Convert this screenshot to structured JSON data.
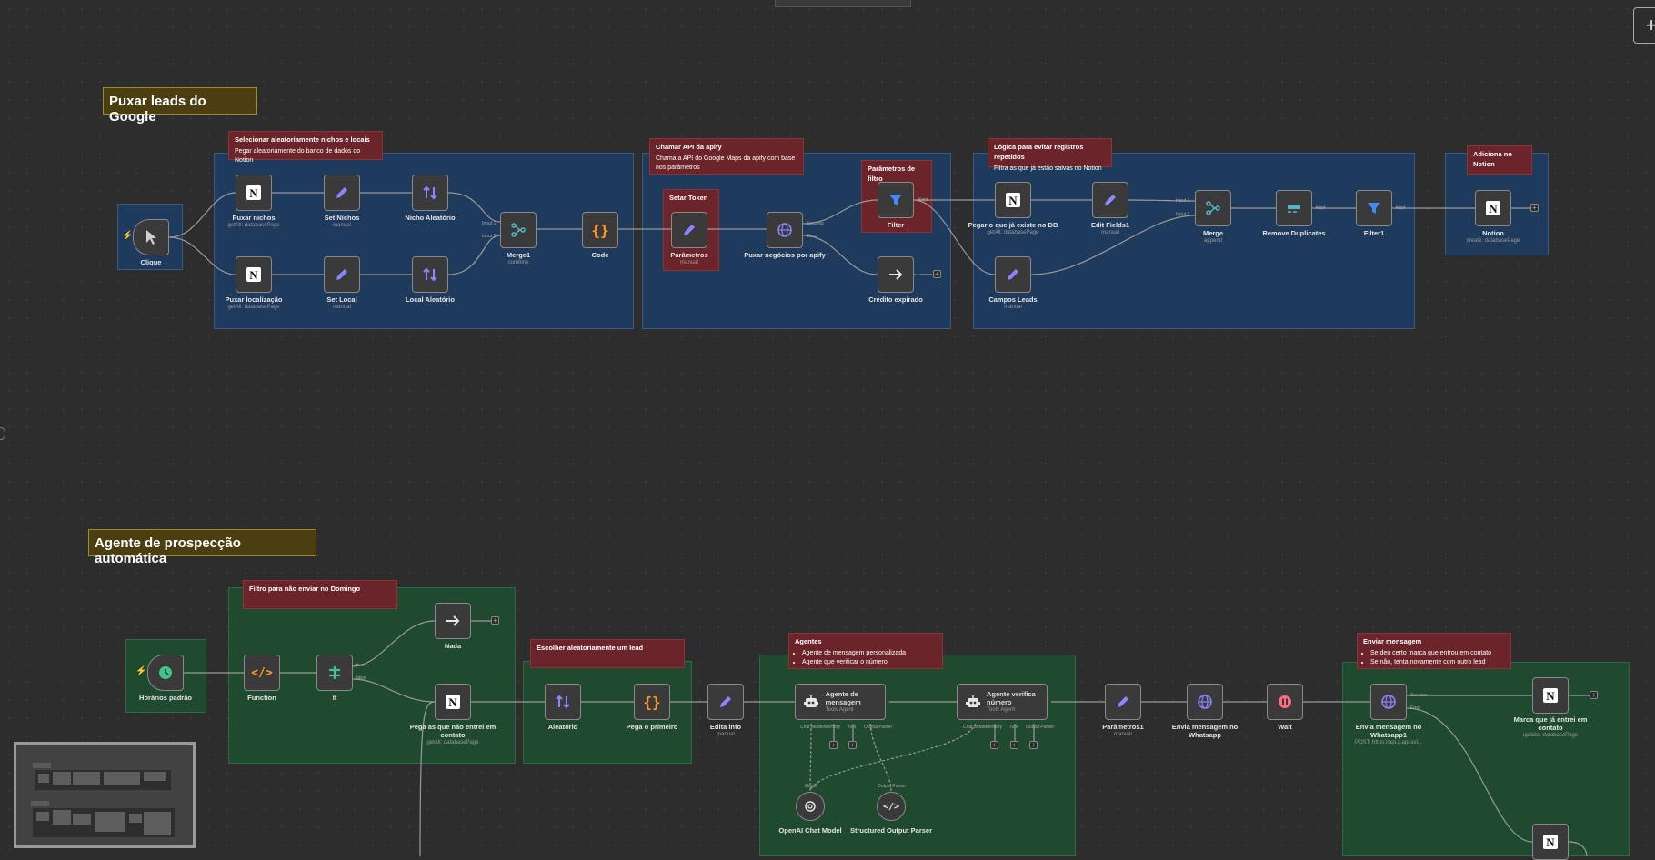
{
  "top_bar": {
    "visible": true
  },
  "add_button_label": "+",
  "sections": [
    {
      "title": "Puxar leads do Google"
    },
    {
      "title": "Agente de prospecção automática"
    }
  ],
  "stickies": {
    "s1": {
      "title": "Selecionar aleatoriamente nichos e locais",
      "body": "Pegar aleatoriamente do banco de dados do Notion"
    },
    "s2": {
      "title": "Chamar API da apify",
      "body": "Chama a API do Google Maps da apify com base nos parâmetros"
    },
    "s3": {
      "title": "Setar Token",
      "body": ""
    },
    "s4": {
      "title": "Parâmetros de filtro",
      "body": ""
    },
    "s5": {
      "title": "Lógica para evitar registros repetidos",
      "body": "Filtra as que já estão salvas no Notion"
    },
    "s6": {
      "title": "Adiciona no Notion",
      "body": ""
    },
    "s7": {
      "title": "Filtro para não enviar no Domingo",
      "body": ""
    },
    "s8": {
      "title": "Escolher aleatoriamente um lead",
      "body": ""
    },
    "s9": {
      "title": "Agentes",
      "items": [
        "Agente de mensagem personalizada",
        "Agente que verificar o número"
      ]
    },
    "s10": {
      "title": "Enviar mensagem",
      "items": [
        "Se deu certo marca que entrou em contato",
        "Se não, tenta novamente com outro lead"
      ]
    }
  },
  "nodes": {
    "clique": {
      "name": "Clique",
      "sub": ""
    },
    "puxar_nichos": {
      "name": "Puxar nichos",
      "sub": "getAll: databasePage"
    },
    "set_nichos": {
      "name": "Set Nichos",
      "sub": "manual"
    },
    "nicho_aleatorio": {
      "name": "Nicho Aleatório",
      "sub": ""
    },
    "puxar_localizacao": {
      "name": "Puxar localização",
      "sub": "getAll: databasePage"
    },
    "set_local": {
      "name": "Set Local",
      "sub": "manual"
    },
    "local_aleatorio": {
      "name": "Local Aleatório",
      "sub": ""
    },
    "merge1": {
      "name": "Merge1",
      "sub": "combine"
    },
    "code": {
      "name": "Code",
      "sub": ""
    },
    "parametros": {
      "name": "Parâmetros",
      "sub": "manual"
    },
    "puxar_negocios": {
      "name": "Puxar negócios por apify",
      "sub": ""
    },
    "filter": {
      "name": "Filter",
      "sub": ""
    },
    "credito_expirado": {
      "name": "Crédito expirado",
      "sub": ""
    },
    "pegar_db": {
      "name": "Pegar o que já existe no DB",
      "sub": "getAll: databasePage"
    },
    "edit_fields1": {
      "name": "Edit Fields1",
      "sub": "manual"
    },
    "campos_leads": {
      "name": "Campos Leads",
      "sub": "manual"
    },
    "merge": {
      "name": "Merge",
      "sub": "append"
    },
    "remove_duplicates": {
      "name": "Remove Duplicates",
      "sub": ""
    },
    "filter1": {
      "name": "Filter1",
      "sub": ""
    },
    "notion": {
      "name": "Notion",
      "sub": "create: databasePage"
    },
    "horarios": {
      "name": "Horários padrão",
      "sub": ""
    },
    "function": {
      "name": "Function",
      "sub": ""
    },
    "if": {
      "name": "If",
      "sub": ""
    },
    "nada": {
      "name": "Nada",
      "sub": ""
    },
    "pega_nao_entrei": {
      "name": "Pega as que não entrei em contato",
      "sub": "getAll: databasePage"
    },
    "aleatorio": {
      "name": "Aleatório",
      "sub": ""
    },
    "pega_primeiro": {
      "name": "Pega o primeiro",
      "sub": ""
    },
    "edita_info": {
      "name": "Edita info",
      "sub": "manual"
    },
    "agente_mensagem": {
      "name": "Agente de mensagem",
      "sub": "Tools Agent"
    },
    "agente_verifica": {
      "name": "Agente verifica número",
      "sub": "Tools Agent"
    },
    "parametros1": {
      "name": "Parâmetros1",
      "sub": "manual"
    },
    "envia_whatsapp": {
      "name": "Envia mensagem no Whatsapp",
      "sub": ""
    },
    "wait": {
      "name": "Wait",
      "sub": ""
    },
    "envia_whatsapp1": {
      "name": "Envia mensagem no Whatsapp1",
      "sub": "POST: https://api.z-api.io/i..."
    },
    "marca_contato": {
      "name": "Marca que já entrei em contato",
      "sub": "update: databasePage"
    },
    "openai_model": {
      "name": "OpenAI Chat Model",
      "sub": ""
    },
    "structured_parser": {
      "name": "Structured Output Parser",
      "sub": ""
    }
  },
  "ports": {
    "input1": "Input 1",
    "input2": "Input 2",
    "success": "Success",
    "error": "Error",
    "kept": "Kept",
    "true": "true",
    "false": "false",
    "chat_model": "Chat Model",
    "memory": "Memory",
    "tool": "Tool",
    "output_parser": "Output Parser",
    "model": "Model"
  },
  "colors": {
    "canvas": "#2d2d2d",
    "group_blue": "#1e3a5c",
    "group_green": "#1f4a30",
    "sticky_red": "#6b2429",
    "section_gold": "#4b3f12",
    "notion": "#ffffff",
    "edit": "#8b86ff",
    "sort": "#8b86ff",
    "merge": "#53b5c9",
    "code": "#ff9b26",
    "http": "#8b86ff",
    "filter": "#3d8bfd",
    "wait": "#ff6b81",
    "if": "#3fc58a",
    "schedule": "#3fc58a"
  }
}
